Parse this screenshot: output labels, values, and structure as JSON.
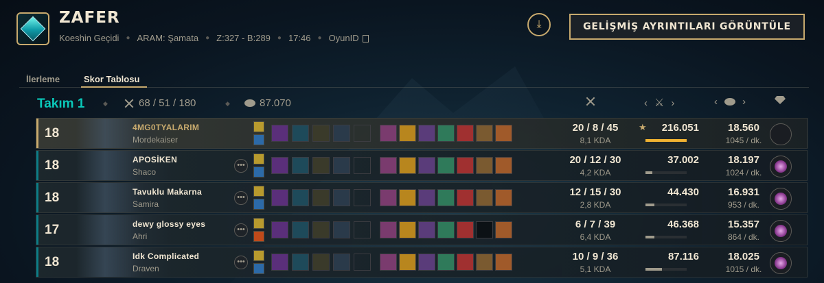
{
  "header": {
    "title": "ZAFER",
    "map": "Koeshin Geçidi",
    "mode": "ARAM: Şamata",
    "score": "Z:327 - B:289",
    "duration": "17:46",
    "game_id_label": "OyunID",
    "advanced_button": "GELİŞMİŞ AYRINTILARI GÖRÜNTÜLE",
    "download_icon": "download-icon"
  },
  "tabs": [
    {
      "label": "İlerleme",
      "active": false
    },
    {
      "label": "Skor Tablosu",
      "active": true
    }
  ],
  "team": {
    "name": "Takım 1",
    "kda": "68 / 51 / 180",
    "gold": "87.070"
  },
  "colors": {
    "accent_gold": "#c8aa6e",
    "team_teal": "#0ac8b9",
    "self_bar": "#f0b232"
  },
  "players": [
    {
      "level": "18",
      "name": "4MG0TYALARIM",
      "champion": "Mordekaiser",
      "kda": "20 / 8 / 45",
      "kda_ratio": "8,1 KDA",
      "damage": "216.051",
      "damage_share": 1.0,
      "top_damage": true,
      "gold": "18.560",
      "gold_per_min": "1045 / dk.",
      "honor": false,
      "self": true,
      "items": [
        1,
        1,
        1,
        1,
        1,
        1,
        1
      ],
      "empty_slots": 0
    },
    {
      "level": "18",
      "name": "APOSİKEN",
      "champion": "Shaco",
      "kda": "20 / 12 / 30",
      "kda_ratio": "4,2 KDA",
      "damage": "37.002",
      "damage_share": 0.17,
      "top_damage": false,
      "gold": "18.197",
      "gold_per_min": "1024 / dk.",
      "honor": true,
      "self": false,
      "items": [
        1,
        1,
        1,
        1,
        1,
        1,
        1
      ],
      "empty_slots": 0
    },
    {
      "level": "18",
      "name": "Tavuklu Makarna",
      "champion": "Samira",
      "kda": "12 / 15 / 30",
      "kda_ratio": "2,8 KDA",
      "damage": "44.430",
      "damage_share": 0.21,
      "top_damage": false,
      "gold": "16.931",
      "gold_per_min": "953 / dk.",
      "honor": true,
      "self": false,
      "items": [
        1,
        1,
        1,
        1,
        1,
        1,
        1
      ],
      "empty_slots": 0
    },
    {
      "level": "17",
      "name": "dewy glossy eyes",
      "champion": "Ahri",
      "kda": "6 / 7 / 39",
      "kda_ratio": "6,4 KDA",
      "damage": "46.368",
      "damage_share": 0.21,
      "top_damage": false,
      "gold": "15.357",
      "gold_per_min": "864 / dk.",
      "honor": true,
      "self": false,
      "items": [
        1,
        1,
        1,
        1,
        1,
        0,
        1
      ],
      "empty_slots": 1
    },
    {
      "level": "18",
      "name": "Idk Complicated",
      "champion": "Draven",
      "kda": "10 / 9 / 36",
      "kda_ratio": "5,1 KDA",
      "damage": "87.116",
      "damage_share": 0.4,
      "top_damage": false,
      "gold": "18.025",
      "gold_per_min": "1015 / dk.",
      "honor": true,
      "self": false,
      "items": [
        1,
        1,
        1,
        1,
        1,
        1,
        1
      ],
      "empty_slots": 0
    }
  ]
}
